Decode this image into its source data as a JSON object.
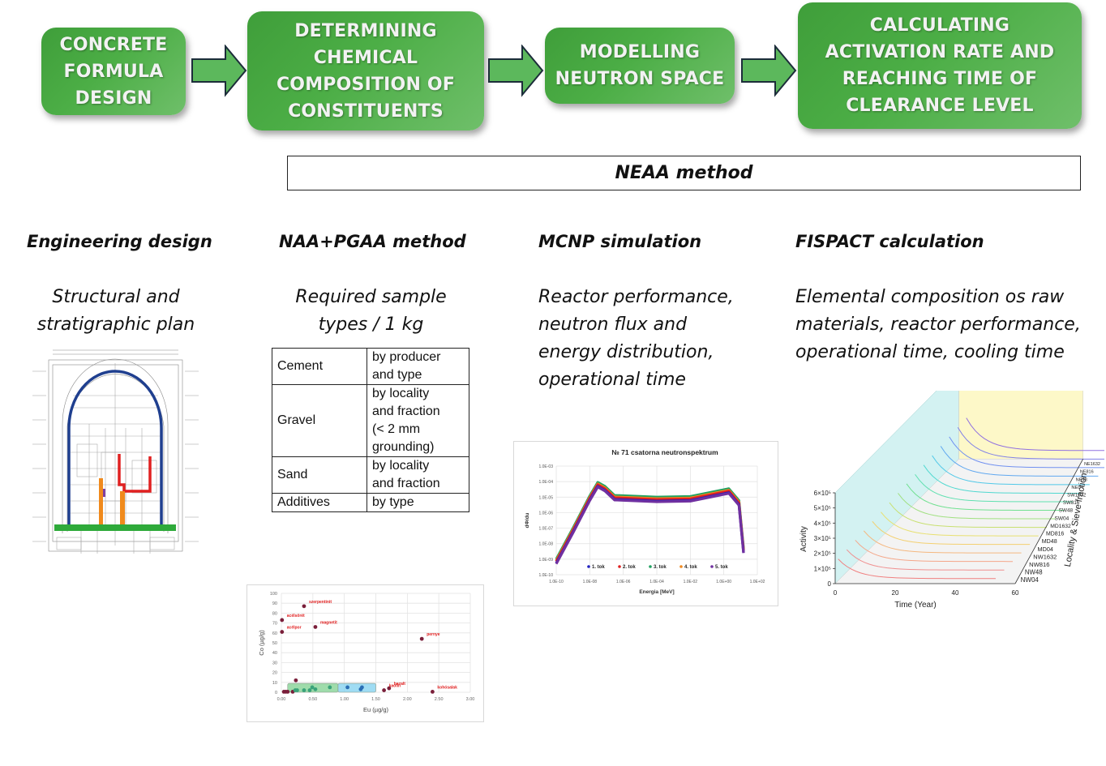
{
  "flow": {
    "steps": [
      {
        "label": "CONCRETE\nFORMULA\nDESIGN"
      },
      {
        "label": "DETERMINING\nCHEMICAL\nCOMPOSITION OF\nCONSTITUENTS"
      },
      {
        "label": "MODELLING\nNEUTRON SPACE"
      },
      {
        "label": "CALCULATING\nACTIVATION RATE AND\nREACHING TIME OF\nCLEARANCE LEVEL"
      }
    ],
    "method_box": "NEAA method",
    "colors": {
      "step_green": "#4cae46",
      "arrow_fill": "#5cb85c",
      "arrow_stroke": "#1c2d3a"
    }
  },
  "columns": [
    {
      "title": "Engineering design",
      "description": "Structural and\nstratigraphic plan"
    },
    {
      "title": "NAA+PGAA method",
      "description": "Required sample\ntypes / 1 kg"
    },
    {
      "title": "MCNP simulation",
      "description": "Reactor performance,\nneutron flux and\nenergy distribution,\noperational time"
    },
    {
      "title": "FISPACT calculation",
      "description": "Elemental composition os raw\nmaterials, reactor performance,\noperational time, cooling time"
    }
  ],
  "sample_table": {
    "rows": [
      {
        "material": "Cement",
        "criteria": "by   producer\nand  type"
      },
      {
        "material": "Gravel",
        "criteria": "by locality\nand fraction\n(< 2 mm\ngrounding)"
      },
      {
        "material": "Sand",
        "criteria": "by locality\nand fraction"
      },
      {
        "material": "Additives",
        "criteria": "by type"
      }
    ]
  },
  "drawing": {
    "description": "Reactor building cross-section",
    "highlight_colors": {
      "dome_liner": "#1f3f8f",
      "shield_red": "#e02020",
      "shield_orange": "#f08a1c",
      "base_slab": "#2eaa3a"
    }
  },
  "chart_data": [
    {
      "type": "scatter",
      "title": "",
      "xlabel": "Eu (µg/g)",
      "ylabel": "Co (µg/g)",
      "xlim": [
        0,
        3
      ],
      "ylim": [
        0,
        100
      ],
      "x_ticks": [
        "0.00",
        "0.50",
        "1.00",
        "1.50",
        "2.00",
        "2.50",
        "3.00"
      ],
      "y_ticks": [
        "0",
        "10",
        "20",
        "30",
        "40",
        "50",
        "60",
        "70",
        "80",
        "90",
        "100"
      ],
      "grid": true,
      "series": [
        {
          "name": "labeled",
          "color": "#7a1f3a",
          "points": [
            {
              "x": 0.01,
              "y": 73,
              "label": "acélsörét"
            },
            {
              "x": 0.01,
              "y": 61,
              "label": "acélpor"
            },
            {
              "x": 0.36,
              "y": 87,
              "label": "szerpentinit"
            },
            {
              "x": 0.54,
              "y": 66,
              "label": "magnetit"
            },
            {
              "x": 2.23,
              "y": 54,
              "label": "pernye"
            },
            {
              "x": 1.63,
              "y": 2,
              "label": "kaolin"
            },
            {
              "x": 1.71,
              "y": 4,
              "label": "bazalt"
            },
            {
              "x": 2.4,
              "y": 0.5,
              "label": "kohósalak"
            }
          ]
        },
        {
          "name": "unlabeled",
          "color": "#7a1f3a",
          "points": [
            {
              "x": 0.23,
              "y": 12
            },
            {
              "x": 0.04,
              "y": 0.5
            },
            {
              "x": 0.07,
              "y": 0.5
            },
            {
              "x": 0.1,
              "y": 0.5
            },
            {
              "x": 0.18,
              "y": 0.5
            }
          ]
        },
        {
          "name": "green-group",
          "color": "#3aa37a",
          "points": [
            {
              "x": 0.22,
              "y": 2
            },
            {
              "x": 0.25,
              "y": 2
            },
            {
              "x": 0.36,
              "y": 2
            },
            {
              "x": 0.45,
              "y": 2
            },
            {
              "x": 0.49,
              "y": 5
            },
            {
              "x": 0.54,
              "y": 3
            },
            {
              "x": 0.77,
              "y": 5
            }
          ]
        },
        {
          "name": "blue-group",
          "color": "#2a6fb5",
          "points": [
            {
              "x": 1.05,
              "y": 5
            },
            {
              "x": 1.26,
              "y": 3
            },
            {
              "x": 1.28,
              "y": 5
            }
          ]
        }
      ],
      "regions": [
        {
          "name": "green-zone",
          "x": [
            0.1,
            0.9
          ],
          "y": [
            0,
            9
          ],
          "color": "#7fd08f"
        },
        {
          "name": "blue-zone",
          "x": [
            0.9,
            1.5
          ],
          "y": [
            0,
            9
          ],
          "color": "#7fd0ef"
        }
      ]
    },
    {
      "type": "scatter",
      "title": "№ 71 csatorna neutronspektrum",
      "xlabel": "Energia [MeV]",
      "ylabel": "dΦ/du",
      "x_scale": "log",
      "y_scale": "log",
      "xlim": [
        1e-10,
        100
      ],
      "ylim": [
        1e-10,
        0.001
      ],
      "x_ticks": [
        "1.0E-10",
        "1.0E-08",
        "1.0E-06",
        "1.0E-04",
        "1.0E-02",
        "1.0E+00",
        "1.0E+02"
      ],
      "y_ticks": [
        "1.0E-03",
        "1.0E-04",
        "1.0E-05",
        "1.0E-06",
        "1.0E-07",
        "1.0E-08",
        "1.0E-09",
        "1.0E-10"
      ],
      "legend": "bottom-inside",
      "grid": true,
      "series": [
        {
          "name": "1. tok",
          "color": "#2020c0",
          "scale": 0.55
        },
        {
          "name": "2. tok",
          "color": "#e02020",
          "scale": 0.7
        },
        {
          "name": "3. tok",
          "color": "#20a060",
          "scale": 1.0
        },
        {
          "name": "4. tok",
          "color": "#f08a20",
          "scale": 0.8
        },
        {
          "name": "5. tok",
          "color": "#7030a0",
          "scale": 0.5
        }
      ],
      "shape_points": [
        {
          "e": 1e-10,
          "v": 1e-09
        },
        {
          "e": 1e-09,
          "v": 1e-07
        },
        {
          "e": 1e-08,
          "v": 1.2e-05
        },
        {
          "e": 3e-08,
          "v": 9e-05
        },
        {
          "e": 8e-08,
          "v": 5e-05
        },
        {
          "e": 3e-07,
          "v": 1.3e-05
        },
        {
          "e": 0.0001,
          "v": 1e-05
        },
        {
          "e": 0.01,
          "v": 1.1e-05
        },
        {
          "e": 2,
          "v": 3.5e-05
        },
        {
          "e": 8,
          "v": 6e-06
        },
        {
          "e": 15,
          "v": 5e-09
        }
      ]
    },
    {
      "type": "line",
      "title": "",
      "xlabel": "Time (Year)",
      "ylabel": "Activity",
      "zlabel": "Locality & Sieve fraction",
      "xlim": [
        0,
        60
      ],
      "ylim": [
        0,
        600000
      ],
      "x_ticks": [
        "0",
        "20",
        "40",
        "60"
      ],
      "y_ticks": [
        "0",
        "1×10⁵",
        "2×10⁵",
        "3×10⁵",
        "4×10⁵",
        "5×10⁵",
        "6×10⁵"
      ],
      "categories": [
        "NW04",
        "NW48",
        "NW816",
        "NW1632",
        "MD04",
        "MD48",
        "MD816",
        "MD1632",
        "SW04",
        "SW48",
        "SW816",
        "SW1632",
        "NE04",
        "NE48",
        "NE816",
        "NE1632"
      ],
      "series_colors": [
        "#f08080",
        "#f09090",
        "#f4a78a",
        "#f4b880",
        "#f3d070",
        "#e8e070",
        "#c8e070",
        "#a0e080",
        "#70e090",
        "#60e0b0",
        "#50d8d0",
        "#50c8e8",
        "#60a8f0",
        "#7090f0",
        "#8080e8",
        "#9070e0"
      ]
    }
  ]
}
